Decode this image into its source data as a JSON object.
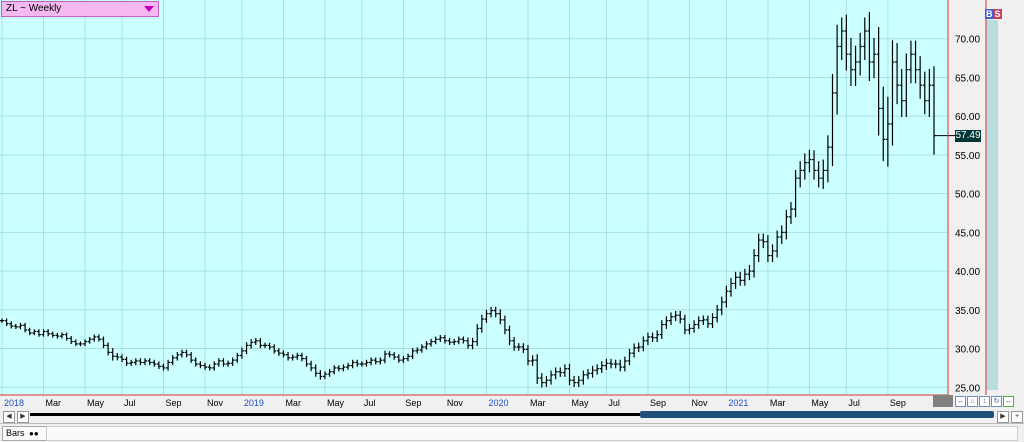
{
  "symbol_box": {
    "label": "ZL ~ Weekly"
  },
  "indicators": {
    "b": "B",
    "s": "S"
  },
  "last_price": "57.49",
  "status": {
    "tab_label": "Bars"
  },
  "colors": {
    "background": "#ccffff",
    "bar": "#000000",
    "grid": "#a8e0e0",
    "axis_line": "#e03030",
    "year_label": "#2050c0"
  },
  "chart_data": {
    "type": "ohlc",
    "title": "ZL ~ Weekly",
    "xlabel": "",
    "ylabel": "",
    "ylim": [
      24,
      75
    ],
    "grid": true,
    "yticks": [
      25,
      30,
      35,
      40,
      45,
      50,
      55,
      60,
      65,
      70
    ],
    "ytick_labels": [
      "25.00",
      "30.00",
      "35.00",
      "40.00",
      "45.00",
      "50.00",
      "55.00",
      "60.00",
      "65.00",
      "70.00"
    ],
    "x_labels": [
      {
        "label": "2018",
        "year": true
      },
      {
        "label": "Mar",
        "year": false
      },
      {
        "label": "May",
        "year": false
      },
      {
        "label": "Jul",
        "year": false
      },
      {
        "label": "Sep",
        "year": false
      },
      {
        "label": "Nov",
        "year": false
      },
      {
        "label": "2019",
        "year": true
      },
      {
        "label": "Mar",
        "year": false
      },
      {
        "label": "May",
        "year": false
      },
      {
        "label": "Jul",
        "year": false
      },
      {
        "label": "Sep",
        "year": false
      },
      {
        "label": "Nov",
        "year": false
      },
      {
        "label": "2020",
        "year": true
      },
      {
        "label": "Mar",
        "year": false
      },
      {
        "label": "May",
        "year": false
      },
      {
        "label": "Jul",
        "year": false
      },
      {
        "label": "Sep",
        "year": false
      },
      {
        "label": "Nov",
        "year": false
      },
      {
        "label": "2021",
        "year": true
      },
      {
        "label": "Mar",
        "year": false
      },
      {
        "label": "May",
        "year": false
      },
      {
        "label": "Jul",
        "year": false
      },
      {
        "label": "Sep",
        "year": false
      }
    ],
    "x_label_week": [
      0,
      9,
      18,
      26,
      35,
      44,
      52,
      61,
      70,
      78,
      87,
      96,
      105,
      114,
      123,
      131,
      140,
      149,
      157,
      166,
      175,
      183,
      192
    ],
    "last_price": 57.49,
    "close": [
      33.6,
      33.2,
      32.9,
      32.8,
      33.0,
      32.4,
      32.0,
      32.2,
      31.8,
      32.2,
      31.9,
      31.7,
      31.6,
      31.8,
      31.3,
      30.9,
      30.6,
      30.6,
      30.9,
      31.2,
      31.5,
      31.2,
      30.4,
      29.5,
      29.0,
      28.9,
      28.6,
      28.1,
      28.2,
      28.4,
      28.2,
      28.4,
      28.2,
      28.0,
      27.7,
      27.5,
      28.2,
      28.8,
      29.2,
      29.5,
      29.2,
      28.5,
      28.0,
      27.8,
      27.6,
      27.5,
      28.0,
      28.4,
      28.0,
      28.1,
      28.5,
      29.1,
      29.7,
      30.4,
      30.8,
      31.0,
      30.4,
      30.4,
      30.2,
      29.7,
      29.4,
      29.2,
      28.8,
      28.9,
      29.1,
      28.7,
      28.0,
      27.5,
      26.8,
      26.4,
      26.7,
      27.0,
      27.5,
      27.4,
      27.6,
      27.8,
      28.2,
      28.0,
      28.0,
      28.2,
      28.5,
      28.3,
      28.5,
      29.3,
      29.2,
      28.9,
      28.5,
      28.7,
      29.0,
      29.7,
      29.8,
      30.2,
      30.6,
      30.9,
      31.2,
      31.4,
      31.0,
      30.8,
      30.9,
      31.2,
      31.0,
      30.4,
      30.9,
      32.6,
      33.8,
      34.5,
      34.9,
      34.5,
      33.7,
      32.4,
      31.0,
      30.2,
      30.2,
      29.9,
      28.4,
      28.5,
      26.2,
      25.6,
      25.9,
      26.6,
      27.0,
      26.9,
      27.4,
      25.9,
      25.6,
      25.9,
      26.6,
      26.8,
      27.2,
      27.4,
      27.8,
      28.1,
      28.0,
      28.0,
      27.6,
      28.4,
      29.4,
      30.1,
      30.2,
      31.0,
      31.5,
      31.4,
      31.8,
      33.1,
      33.6,
      34.1,
      34.3,
      33.8,
      32.4,
      32.6,
      33.1,
      33.6,
      33.7,
      33.2,
      34.0,
      35.0,
      36.0,
      37.4,
      38.4,
      39.2,
      38.8,
      39.6,
      40.0,
      42.0,
      44.0,
      43.8,
      42.0,
      42.6,
      44.4,
      45.0,
      47.0,
      48.0,
      52.0,
      53.0,
      54.0,
      54.4,
      53.0,
      52.0,
      53.0,
      56.0,
      63.0,
      69.0,
      71.0,
      68.0,
      66.0,
      67.0,
      69.0,
      71.0,
      67.0,
      68.0,
      61.0,
      57.0,
      59.0,
      67.0,
      64.0,
      62.0,
      66.0,
      68.0,
      66.0,
      64.0,
      62.0,
      64.0,
      57.49
    ],
    "range": [
      0.8,
      0.8,
      0.9,
      0.8,
      0.9,
      0.9,
      0.8,
      0.8,
      0.8,
      0.8,
      0.9,
      0.8,
      0.9,
      0.8,
      0.8,
      0.9,
      0.8,
      0.9,
      0.8,
      0.8,
      0.9,
      0.9,
      1.0,
      1.1,
      1.6,
      1.2,
      1.0,
      1.0,
      1.0,
      1.0,
      1.0,
      1.0,
      1.0,
      1.0,
      1.0,
      1.0,
      1.0,
      1.0,
      1.0,
      1.0,
      1.0,
      1.0,
      1.0,
      1.0,
      1.0,
      1.0,
      1.0,
      1.0,
      1.0,
      1.0,
      1.0,
      1.0,
      1.2,
      1.2,
      1.2,
      1.0,
      1.0,
      1.0,
      1.0,
      1.0,
      1.0,
      1.0,
      1.0,
      1.0,
      1.0,
      1.0,
      1.0,
      1.2,
      1.3,
      1.2,
      1.0,
      1.0,
      1.0,
      1.0,
      1.0,
      1.0,
      1.0,
      1.0,
      1.0,
      1.0,
      1.0,
      1.0,
      1.0,
      1.2,
      1.0,
      1.0,
      1.0,
      1.0,
      1.0,
      1.0,
      1.0,
      1.0,
      1.0,
      1.0,
      1.0,
      1.0,
      1.0,
      1.0,
      1.0,
      1.0,
      1.0,
      1.2,
      1.4,
      1.6,
      1.6,
      1.4,
      1.4,
      1.4,
      1.6,
      1.6,
      1.6,
      1.4,
      1.4,
      1.4,
      1.6,
      1.8,
      2.2,
      1.8,
      1.6,
      1.6,
      1.6,
      1.6,
      1.6,
      1.8,
      1.6,
      1.6,
      1.6,
      1.6,
      1.6,
      1.6,
      1.6,
      1.6,
      1.6,
      1.6,
      1.6,
      1.6,
      1.6,
      1.6,
      1.6,
      1.6,
      1.6,
      1.6,
      1.6,
      1.6,
      1.6,
      1.6,
      1.6,
      1.6,
      1.6,
      1.6,
      1.6,
      1.6,
      1.6,
      1.6,
      1.6,
      1.8,
      2.0,
      2.0,
      2.0,
      2.0,
      2.0,
      2.0,
      2.2,
      2.4,
      2.4,
      2.4,
      2.4,
      2.4,
      2.4,
      2.6,
      2.6,
      2.6,
      3.0,
      3.4,
      3.4,
      3.6,
      3.4,
      3.4,
      4.0,
      4.4,
      7.0,
      8.0,
      5.0,
      6.0,
      6.0,
      6.0,
      5.0,
      5.0,
      7.0,
      6.0,
      10.0,
      8.0,
      10.0,
      8.0,
      7.0,
      6.0,
      6.0,
      5.0,
      5.0,
      5.0,
      5.0,
      6.0,
      7.0
    ]
  }
}
